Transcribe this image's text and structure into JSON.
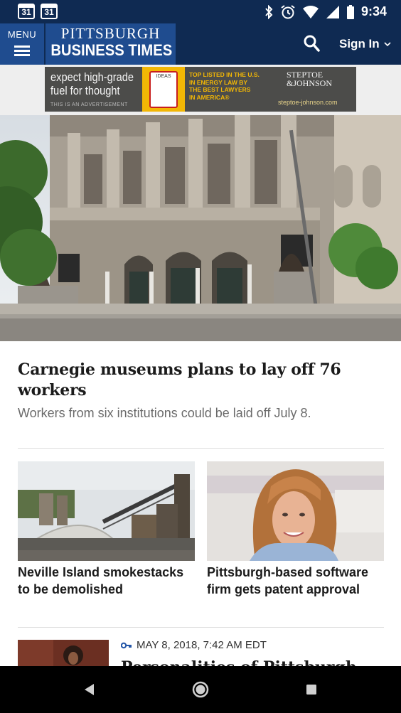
{
  "status_bar": {
    "notifications": [
      "31",
      "31"
    ],
    "time": "9:34",
    "icons": [
      "bluetooth-icon",
      "alarm-icon",
      "wifi-icon",
      "signal-icon",
      "battery-icon"
    ]
  },
  "header": {
    "menu_label": "MENU",
    "logo_line1": "PITTSBURGH",
    "logo_line2": "BUSINESS TIMES",
    "signin_label": "Sign In",
    "colors": {
      "bar": "#0f2a52",
      "accent": "#1f4c8f"
    }
  },
  "ad": {
    "headline_line1": "expect high-grade",
    "headline_line2": "fuel for thought",
    "note": "THIS IS AN ADVERTISEMENT",
    "pump_label": "IDEAS",
    "middle_lines": [
      "TOP LISTED IN THE U.S.",
      "IN ENERGY LAW BY",
      "THE BEST LAWYERS",
      "IN AMERICA®"
    ],
    "firm_line1": "STEPTOE",
    "firm_line2": "&JOHNSON",
    "url": "steptoe-johnson.com"
  },
  "hero": {
    "title": "Carnegie museums plans to lay off 76 workers",
    "subtitle": "Workers from six institutions could be laid off July 8."
  },
  "cards": [
    {
      "title": "Neville Island smokestacks to be demolished"
    },
    {
      "title": "Pittsburgh-based software firm gets patent approval"
    }
  ],
  "list_item": {
    "date": "MAY 8, 2018, 7:42 AM EDT",
    "title": "Personalities of Pittsburgh"
  }
}
